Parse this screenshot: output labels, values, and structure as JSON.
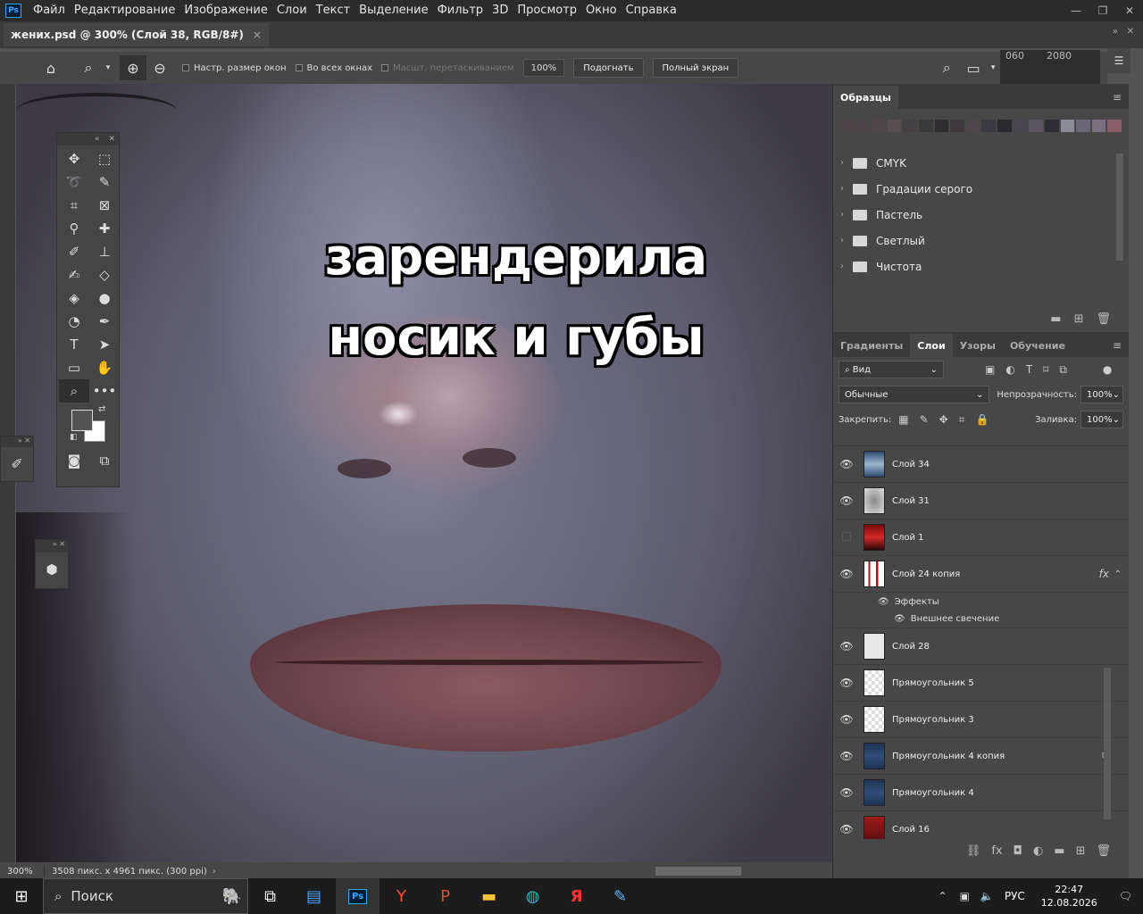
{
  "menubar": {
    "items": [
      "Файл",
      "Редактирование",
      "Изображение",
      "Слои",
      "Текст",
      "Выделение",
      "Фильтр",
      "3D",
      "Просмотр",
      "Окно",
      "Справка"
    ],
    "logo": "Ps"
  },
  "tab": {
    "title": "жених.psd @ 300% (Слой 38, RGB/8#)",
    "close": "×"
  },
  "options": {
    "resize_windows": "Настр. размер окон",
    "all_windows": "Во всех окнах",
    "scrubby_zoom": "Масшт. перетаскиванием",
    "zoom_value": "100%",
    "fit_label": "Подогнать",
    "fullscreen_label": "Полный экран"
  },
  "ruler_top": {
    "left_number": "060",
    "right_number": "2080"
  },
  "canvas": {
    "caption": "зарендерила носик и губы"
  },
  "status": {
    "zoom": "300%",
    "info": "3508 пикс. x 4961 пикс. (300 ppi)"
  },
  "swatches_panel": {
    "tab": "Образцы",
    "colors": [
      "#4c4448",
      "#4a4347",
      "#4f4649",
      "#574e52",
      "#444044",
      "#3a3a3d",
      "#2f2d30",
      "#3d393d",
      "#4d464b",
      "#3b3a40",
      "#2a292e",
      "#4a4650",
      "#5a5560",
      "#2f2c33",
      "#8c8c99",
      "#6c6776",
      "#7a6f7e",
      "#8a5f6a"
    ],
    "folders": [
      "CMYK",
      "Градации серого",
      "Пастель",
      "Светлый",
      "Чистота"
    ]
  },
  "layers_panel": {
    "tabs": [
      "Градиенты",
      "Слои",
      "Узоры",
      "Обучение"
    ],
    "active_tab": "Слои",
    "filter": "Вид",
    "blend_mode": "Обычные",
    "opacity_label": "Непрозрачность:",
    "opacity_value": "100%",
    "lock_label": "Закрепить:",
    "fill_label": "Заливка:",
    "fill_value": "100%",
    "layers": [
      {
        "name": "Слой 34",
        "visible": true
      },
      {
        "name": "Слой 31",
        "visible": true
      },
      {
        "name": "Слой 1",
        "visible": false
      },
      {
        "name": "Слой 24 копия",
        "visible": true
      },
      {
        "name": "Слой 28",
        "visible": true
      },
      {
        "name": "Прямоугольник 5",
        "visible": true
      },
      {
        "name": "Прямоугольник 3",
        "visible": true
      },
      {
        "name": "Прямоугольник 4 копия",
        "visible": true
      },
      {
        "name": "Прямоугольник 4",
        "visible": true
      },
      {
        "name": "Слой 16",
        "visible": true
      }
    ],
    "effects_label": "Эффекты",
    "outer_glow_label": "Внешнее свечение",
    "fx_label": "fx"
  },
  "taskbar": {
    "search_placeholder": "Поиск",
    "lang": "РУС",
    "time": "22:47",
    "date": "12.08.2026"
  }
}
